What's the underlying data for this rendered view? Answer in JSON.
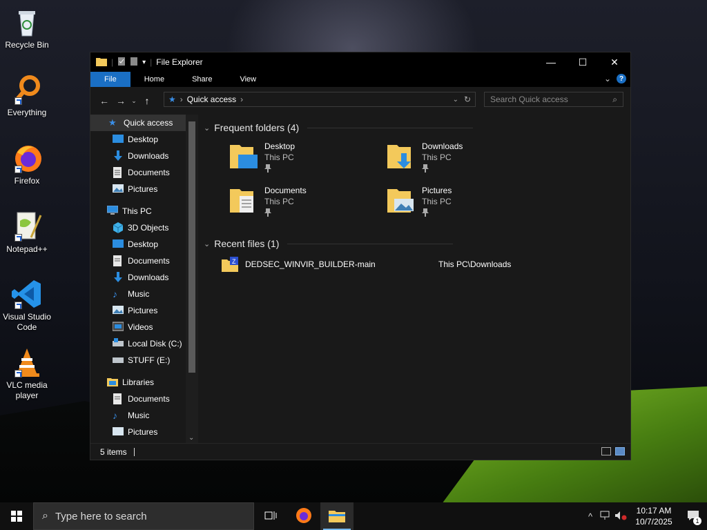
{
  "desktop": {
    "icons": [
      {
        "label": "Recycle Bin",
        "icon": "recycle-bin-icon"
      },
      {
        "label": "Everything",
        "icon": "everything-search-icon"
      },
      {
        "label": "Firefox",
        "icon": "firefox-icon"
      },
      {
        "label": "Notepad++",
        "icon": "notepad-plus-plus-icon"
      },
      {
        "label": "Visual Studio Code",
        "icon": "vscode-icon"
      },
      {
        "label": "VLC media player",
        "icon": "vlc-icon"
      }
    ]
  },
  "window": {
    "title": "File Explorer",
    "ribbon_tabs": [
      "File",
      "Home",
      "Share",
      "View"
    ],
    "address": {
      "crumb": "Quick access"
    },
    "search_placeholder": "Search Quick access",
    "nav": {
      "quick_access": "Quick access",
      "quick_items": [
        "Desktop",
        "Downloads",
        "Documents",
        "Pictures"
      ],
      "this_pc": "This PC",
      "pc_items": [
        "3D Objects",
        "Desktop",
        "Documents",
        "Downloads",
        "Music",
        "Pictures",
        "Videos",
        "Local Disk (C:)",
        "STUFF (E:)"
      ],
      "libraries": "Libraries",
      "lib_items": [
        "Documents",
        "Music",
        "Pictures"
      ]
    },
    "frequent": {
      "header": "Frequent folders (4)",
      "items": [
        {
          "name": "Desktop",
          "location": "This PC"
        },
        {
          "name": "Downloads",
          "location": "This PC"
        },
        {
          "name": "Documents",
          "location": "This PC"
        },
        {
          "name": "Pictures",
          "location": "This PC"
        }
      ]
    },
    "recent": {
      "header": "Recent files (1)",
      "items": [
        {
          "name": "DEDSEC_WINVIR_BUILDER-main",
          "location": "This PC\\Downloads"
        }
      ]
    },
    "status": "5 items"
  },
  "taskbar": {
    "search_placeholder": "Type here to search",
    "time": "10:17 AM",
    "date": "10/7/2025",
    "notification_count": "1"
  },
  "colors": {
    "accent": "#1a6fc4",
    "folder": "#f3c95b"
  }
}
